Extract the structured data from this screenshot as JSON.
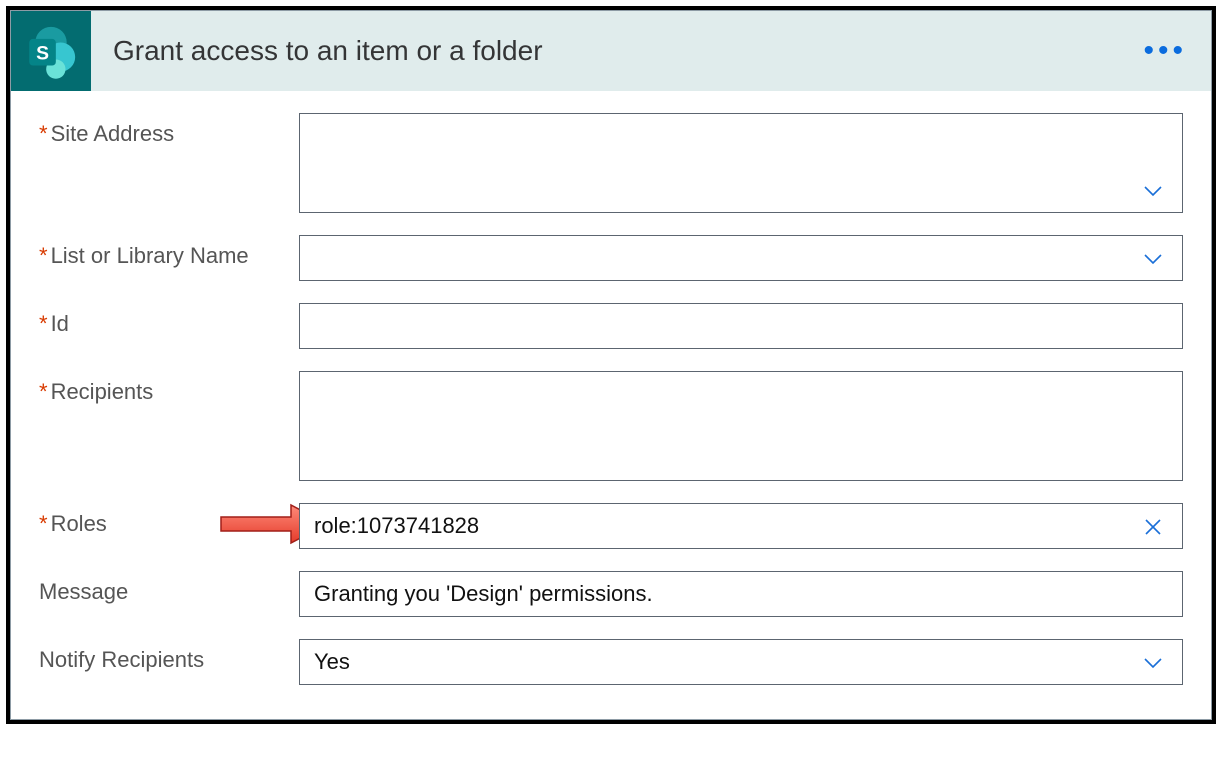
{
  "header": {
    "title": "Grant access to an item or a folder"
  },
  "fields": {
    "siteAddress": {
      "label": "Site Address",
      "required": true,
      "value": ""
    },
    "listName": {
      "label": "List or Library Name",
      "required": true,
      "value": ""
    },
    "id": {
      "label": "Id",
      "required": true,
      "value": ""
    },
    "recipients": {
      "label": "Recipients",
      "required": true,
      "value": ""
    },
    "roles": {
      "label": "Roles",
      "required": true,
      "value": "role:1073741828"
    },
    "message": {
      "label": "Message",
      "required": false,
      "value": "Granting you 'Design' permissions."
    },
    "notify": {
      "label": "Notify Recipients",
      "required": false,
      "value": "Yes"
    }
  }
}
